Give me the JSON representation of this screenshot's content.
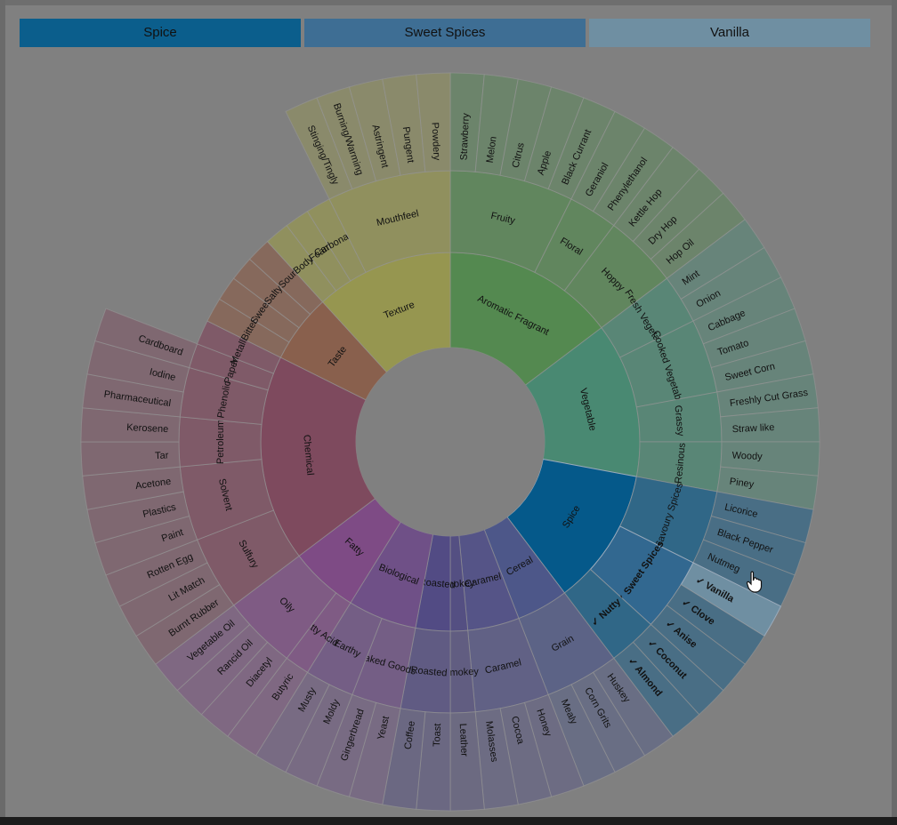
{
  "breadcrumb": {
    "items": [
      {
        "label": "Spice",
        "color": "#0b5e8c"
      },
      {
        "label": "Sweet Spices",
        "color": "#3e6e94"
      },
      {
        "label": "Vanilla",
        "color": "#6f8fa2"
      }
    ]
  },
  "colors": {
    "background": "#808080",
    "selected_spice": "#05598a",
    "selected_sweet": "#326890"
  },
  "chart_data": {
    "type": "sunburst",
    "selected_path": [
      "Spice",
      "Sweet Spices",
      "Vanilla"
    ],
    "categories": [
      {
        "name": "Aromatic Fragrant",
        "color": "#4c8a48",
        "children": [
          {
            "name": "Fruity",
            "children": [
              "Strawberry",
              "Melon",
              "Citrus",
              "Apple",
              "Black Currant"
            ]
          },
          {
            "name": "Floral",
            "children": [
              "Geraniol",
              "Phenylethanol"
            ]
          },
          {
            "name": "Hoppy",
            "children": [
              "Kettle Hop",
              "Dry Hop",
              "Hop Oil"
            ]
          }
        ]
      },
      {
        "name": "Vegetable",
        "color": "#3f8a70",
        "children": [
          {
            "name": "Fresh Vegetable",
            "children": [
              "Mint",
              "Onion"
            ]
          },
          {
            "name": "Cooked Vegetable",
            "children": [
              "Cabbage",
              "Tomato",
              "Sweet Corn"
            ]
          },
          {
            "name": "Grassy",
            "children": [
              "Freshly Cut Grass",
              "Straw like"
            ]
          },
          {
            "name": "Resinous",
            "children": [
              "Woody",
              "Piney"
            ]
          }
        ]
      },
      {
        "name": "Spice",
        "color": "#05598a",
        "children": [
          {
            "name": "Savoury Spices",
            "children": [
              "Licorice",
              "Black Pepper",
              "Nutmeg"
            ]
          },
          {
            "name": "✓ Sweet Spices",
            "children": [
              "✓ Vanilla",
              "✓ Clove",
              "✓ Anise"
            ]
          },
          {
            "name": "✓ Nutty",
            "children": [
              "✓ Coconut",
              "✓ Almond"
            ]
          }
        ]
      },
      {
        "name": "Cereal",
        "color": "#44508a",
        "children": [
          {
            "name": "Grain",
            "children": [
              "Huskey",
              "Corn Grits",
              "Mealy"
            ]
          }
        ]
      },
      {
        "name": "Caramel",
        "color": "#4d4c88",
        "children": [
          {
            "name": "Caramel",
            "children": [
              "Honey",
              "Cocoa",
              "Molasses"
            ]
          }
        ]
      },
      {
        "name": "Smokey",
        "color": "#4c4682",
        "children": [
          {
            "name": "Smokey",
            "children": [
              "Leather"
            ]
          }
        ]
      },
      {
        "name": "Roasted",
        "color": "#4a4285",
        "children": [
          {
            "name": "Roasted",
            "children": [
              "Toast",
              "Coffee"
            ]
          }
        ]
      },
      {
        "name": "Biological",
        "color": "#6c4888",
        "children": [
          {
            "name": "Baked Goods",
            "children": [
              "Yeast",
              "Gingerbread"
            ]
          },
          {
            "name": "Earthy",
            "children": [
              "Moldy",
              "Musty"
            ]
          }
        ]
      },
      {
        "name": "Fatty",
        "color": "#7e4286",
        "children": [
          {
            "name": "Fatty Acid",
            "children": [
              "Butyric"
            ]
          },
          {
            "name": "Oily",
            "children": [
              "Diacetyl",
              "Rancid Oil",
              "Vegetable Oil"
            ]
          }
        ]
      },
      {
        "name": "Chemical",
        "color": "#7e4058",
        "children": [
          {
            "name": "Sulfury",
            "children": [
              "Burnt Rubber",
              "Lit Match",
              "Rotten Egg"
            ]
          },
          {
            "name": "Solvent",
            "children": [
              "Paint",
              "Plastics",
              "Acetone"
            ]
          },
          {
            "name": "Petroleum",
            "children": [
              "Tar",
              "Kerosene"
            ]
          },
          {
            "name": "Phenolic",
            "children": [
              "Pharmaceutical",
              "Iodine"
            ]
          },
          {
            "name": "Papery",
            "children": [
              "Cardboard"
            ]
          },
          {
            "name": "Metallic",
            "children": []
          }
        ]
      },
      {
        "name": "Taste",
        "color": "#8a5a44",
        "children": [
          {
            "name": "Bitter",
            "children": []
          },
          {
            "name": "Sweet",
            "children": []
          },
          {
            "name": "Salty",
            "children": []
          },
          {
            "name": "Sour",
            "children": []
          }
        ]
      },
      {
        "name": "Texture",
        "color": "#9a9a48",
        "children": [
          {
            "name": "Body",
            "children": []
          },
          {
            "name": "Foam",
            "children": []
          },
          {
            "name": "Carbonation",
            "children": []
          },
          {
            "name": "Mouthfeel",
            "children": [
              "Stinging/Tingly",
              "Burning/Warming",
              "Astringent",
              "Pungent",
              "Powdery"
            ]
          }
        ]
      }
    ]
  }
}
